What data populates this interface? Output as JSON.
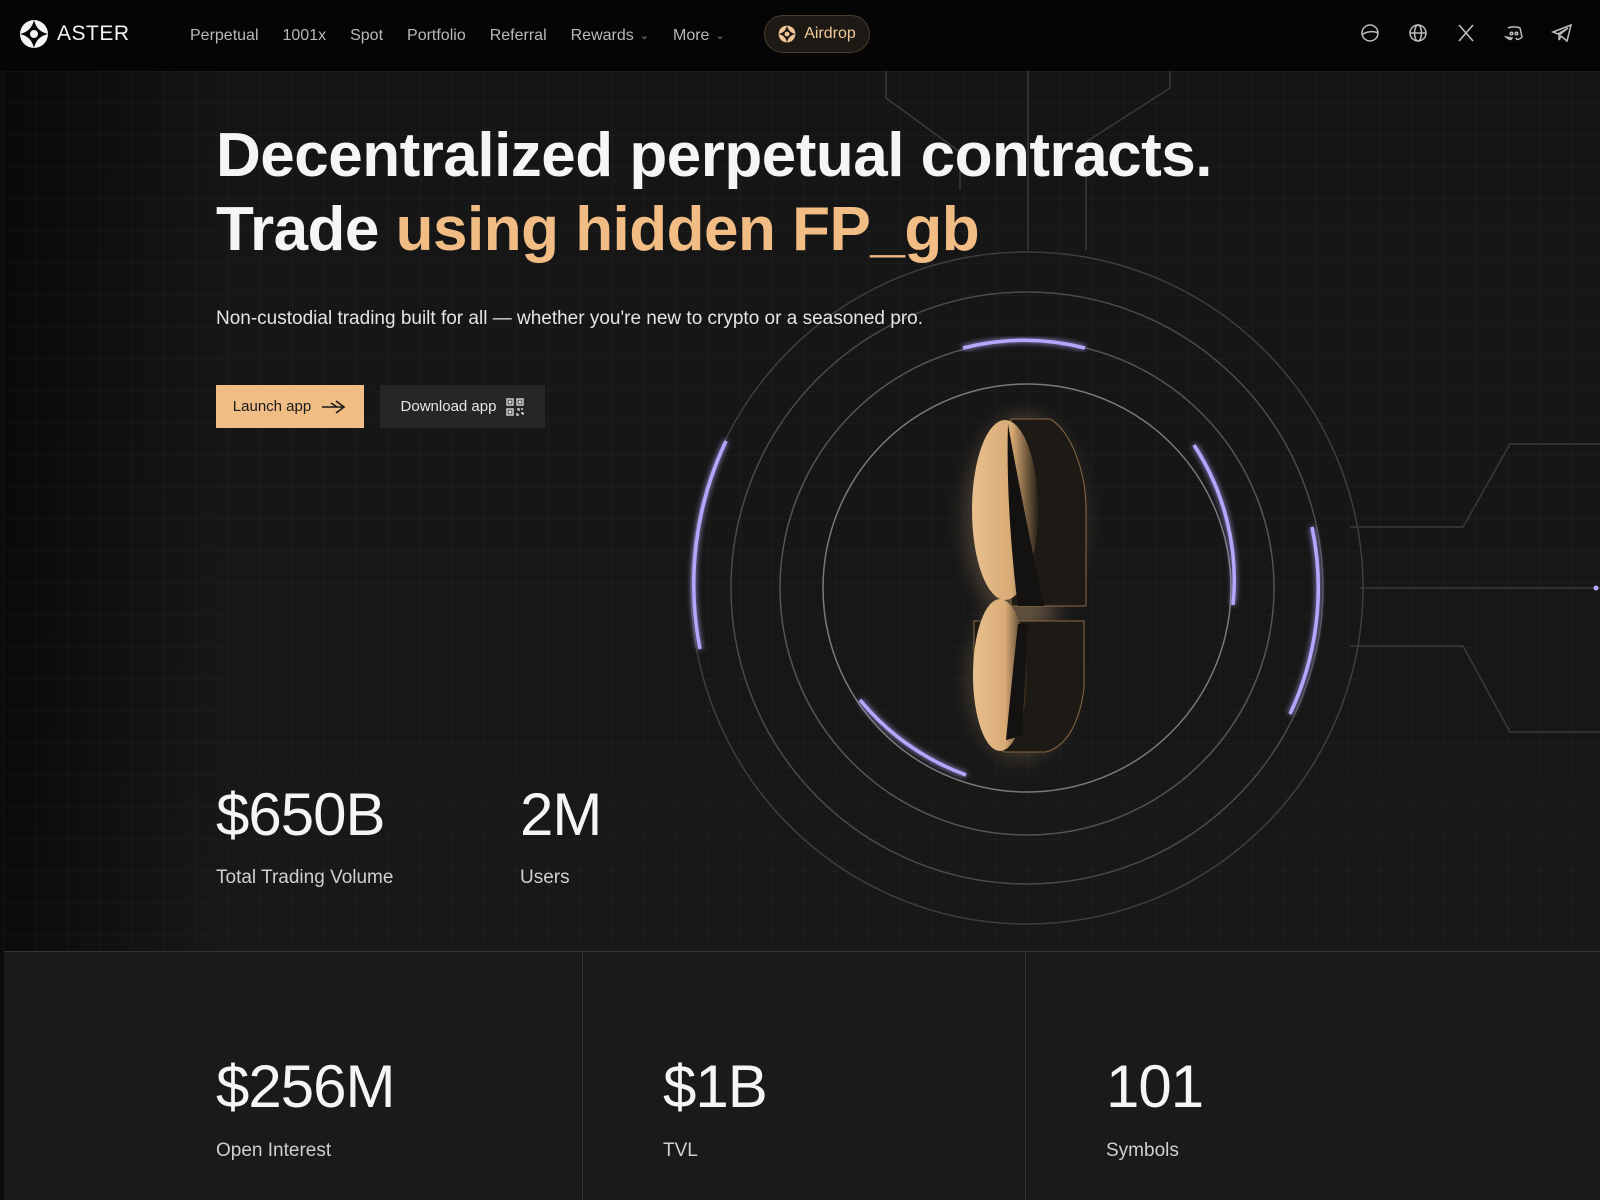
{
  "nav": {
    "brand": "ASTER",
    "links": [
      "Perpetual",
      "1001x",
      "Spot",
      "Portfolio",
      "Referral",
      "Rewards",
      "More"
    ],
    "airdrop_label": "Airdrop",
    "icons": [
      "docs-icon",
      "globe-icon",
      "x-icon",
      "discord-icon",
      "telegram-icon"
    ]
  },
  "hero": {
    "headline_line1": "Decentralized perpetual contracts.",
    "headline_line2_prefix": "Trade ",
    "headline_line2_accent": "using hidden FP_gb",
    "subtitle": "Non-custodial trading built for all — whether you're new to crypto or a seasoned pro.",
    "launch_label": "Launch app",
    "download_label": "Download app"
  },
  "stats_top": [
    {
      "value": "$650B",
      "label": "Total Trading Volume"
    },
    {
      "value": "2M",
      "label": "Users"
    }
  ],
  "stats_bottom": [
    {
      "value": "$256M",
      "label": "Open Interest"
    },
    {
      "value": "$1B",
      "label": "TVL"
    },
    {
      "value": "101",
      "label": "Symbols"
    }
  ],
  "colors": {
    "accent": "#f0bd85",
    "background": "#181818",
    "nav_background": "#050505",
    "ring_glow": "#b5a6ff"
  }
}
